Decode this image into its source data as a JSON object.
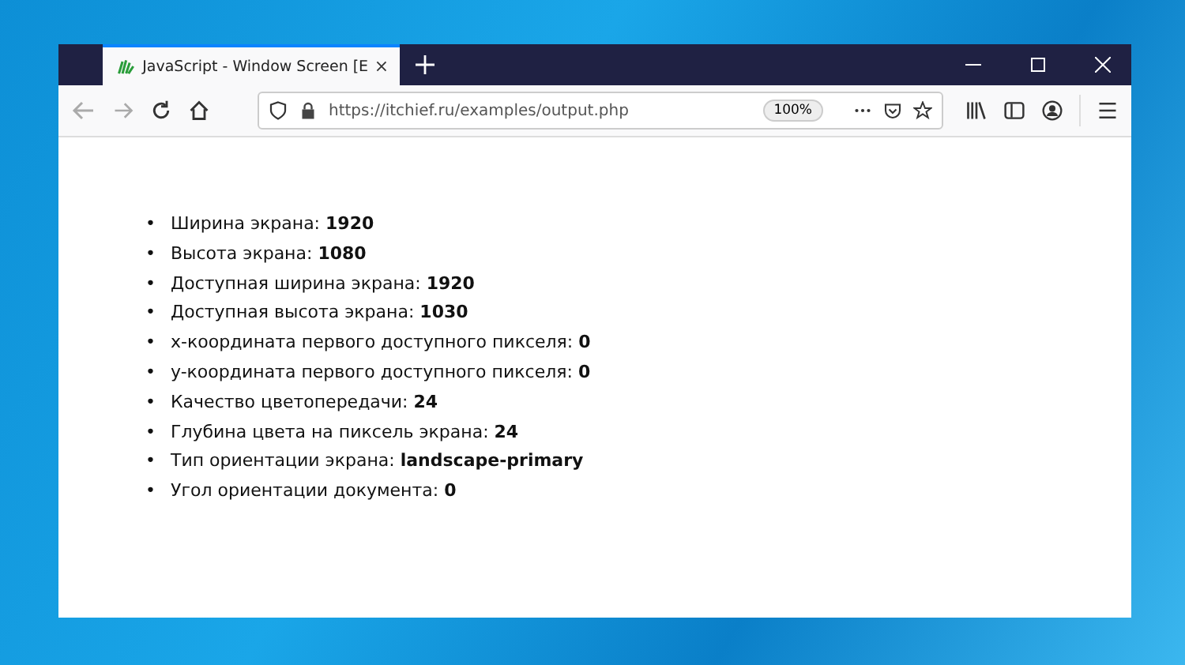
{
  "tab": {
    "title": "JavaScript - Window Screen [E",
    "selected": true
  },
  "toolbar": {
    "url": "https://itchief.ru/examples/output.php",
    "zoom": "100%"
  },
  "items": [
    {
      "bullet": "•",
      "text": "Ширина экрана: **1920**"
    },
    {
      "bullet": "•",
      "text": "Высота экрана: **1080**"
    },
    {
      "bullet": "•",
      "text": "Доступная ширина экрана: **1920**"
    },
    {
      "bullet": "•",
      "text": "Доступная высота экрана: **1030**"
    },
    {
      "bullet": "•",
      "text": "x-координата первого доступного пикселя: **0**"
    },
    {
      "bullet": "•",
      "text": "y-координата первого доступного пикселя: **0**"
    },
    {
      "bullet": "•",
      "text": "Качество цветопередачи: **24**"
    },
    {
      "bullet": "•",
      "text": "Глубина цвета на пиксель экрана: **24**"
    },
    {
      "bullet": "•",
      "text": "Тип ориентации экрана: **landscape-primary**"
    },
    {
      "bullet": "•",
      "text": "Угол ориентации документа: **0**"
    }
  ]
}
